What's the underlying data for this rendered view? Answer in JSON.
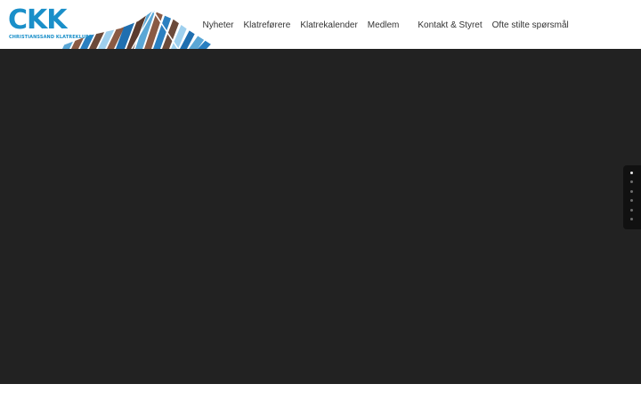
{
  "logo": {
    "mark": "CKK",
    "subtitle": "CHRISTIANSSAND KLATREKLUBB",
    "accent_color": "#1a8fc9",
    "icon": "mountain-stripes-icon"
  },
  "nav": {
    "items": [
      {
        "label": "Nyheter"
      },
      {
        "label": "Klatreførere"
      },
      {
        "label": "Klatrekalender"
      },
      {
        "label": "Medlem"
      },
      {
        "label": "Kontakt & Styret"
      },
      {
        "label": "Ofte stilte spørsmål"
      }
    ]
  },
  "slider": {
    "background": "#222222",
    "slide_count": 6,
    "active_slide": 1
  }
}
